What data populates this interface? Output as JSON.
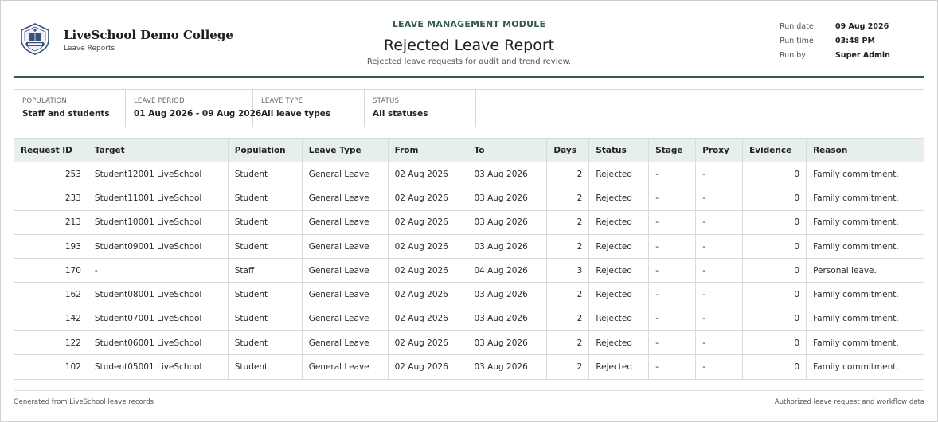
{
  "header": {
    "college_name": "LiveSchool Demo College",
    "college_sub": "Leave Reports",
    "module": "LEAVE MANAGEMENT MODULE",
    "title": "Rejected Leave Report",
    "subtitle": "Rejected leave requests for audit and trend review.",
    "logo_icon": "college-crest-icon",
    "accent_color": "#2f5a4c"
  },
  "meta": [
    {
      "label": "Run date",
      "value": "09 Aug 2026"
    },
    {
      "label": "Run time",
      "value": "03:48 PM"
    },
    {
      "label": "Run by",
      "value": "Super Admin"
    }
  ],
  "filters": [
    {
      "label": "POPULATION",
      "value": "Staff and students"
    },
    {
      "label": "LEAVE PERIOD",
      "value": "01 Aug 2026 - 09 Aug 2026"
    },
    {
      "label": "LEAVE TYPE",
      "value": "All leave types"
    },
    {
      "label": "STATUS",
      "value": "All statuses"
    }
  ],
  "table": {
    "columns": [
      "Request ID",
      "Target",
      "Population",
      "Leave Type",
      "From",
      "To",
      "Days",
      "Status",
      "Stage",
      "Proxy",
      "Evidence",
      "Reason"
    ],
    "rows": [
      [
        "253",
        "Student12001 LiveSchool",
        "Student",
        "General Leave",
        "02 Aug 2026",
        "03 Aug 2026",
        "2",
        "Rejected",
        "-",
        "-",
        "0",
        "Family commitment."
      ],
      [
        "233",
        "Student11001 LiveSchool",
        "Student",
        "General Leave",
        "02 Aug 2026",
        "03 Aug 2026",
        "2",
        "Rejected",
        "-",
        "-",
        "0",
        "Family commitment."
      ],
      [
        "213",
        "Student10001 LiveSchool",
        "Student",
        "General Leave",
        "02 Aug 2026",
        "03 Aug 2026",
        "2",
        "Rejected",
        "-",
        "-",
        "0",
        "Family commitment."
      ],
      [
        "193",
        "Student09001 LiveSchool",
        "Student",
        "General Leave",
        "02 Aug 2026",
        "03 Aug 2026",
        "2",
        "Rejected",
        "-",
        "-",
        "0",
        "Family commitment."
      ],
      [
        "170",
        "-",
        "Staff",
        "General Leave",
        "02 Aug 2026",
        "04 Aug 2026",
        "3",
        "Rejected",
        "-",
        "-",
        "0",
        "Personal leave."
      ],
      [
        "162",
        "Student08001 LiveSchool",
        "Student",
        "General Leave",
        "02 Aug 2026",
        "03 Aug 2026",
        "2",
        "Rejected",
        "-",
        "-",
        "0",
        "Family commitment."
      ],
      [
        "142",
        "Student07001 LiveSchool",
        "Student",
        "General Leave",
        "02 Aug 2026",
        "03 Aug 2026",
        "2",
        "Rejected",
        "-",
        "-",
        "0",
        "Family commitment."
      ],
      [
        "122",
        "Student06001 LiveSchool",
        "Student",
        "General Leave",
        "02 Aug 2026",
        "03 Aug 2026",
        "2",
        "Rejected",
        "-",
        "-",
        "0",
        "Family commitment."
      ],
      [
        "102",
        "Student05001 LiveSchool",
        "Student",
        "General Leave",
        "02 Aug 2026",
        "03 Aug 2026",
        "2",
        "Rejected",
        "-",
        "-",
        "0",
        "Family commitment."
      ]
    ]
  },
  "footer": {
    "left": "Generated from LiveSchool leave records",
    "right": "Authorized leave request and workflow data"
  }
}
